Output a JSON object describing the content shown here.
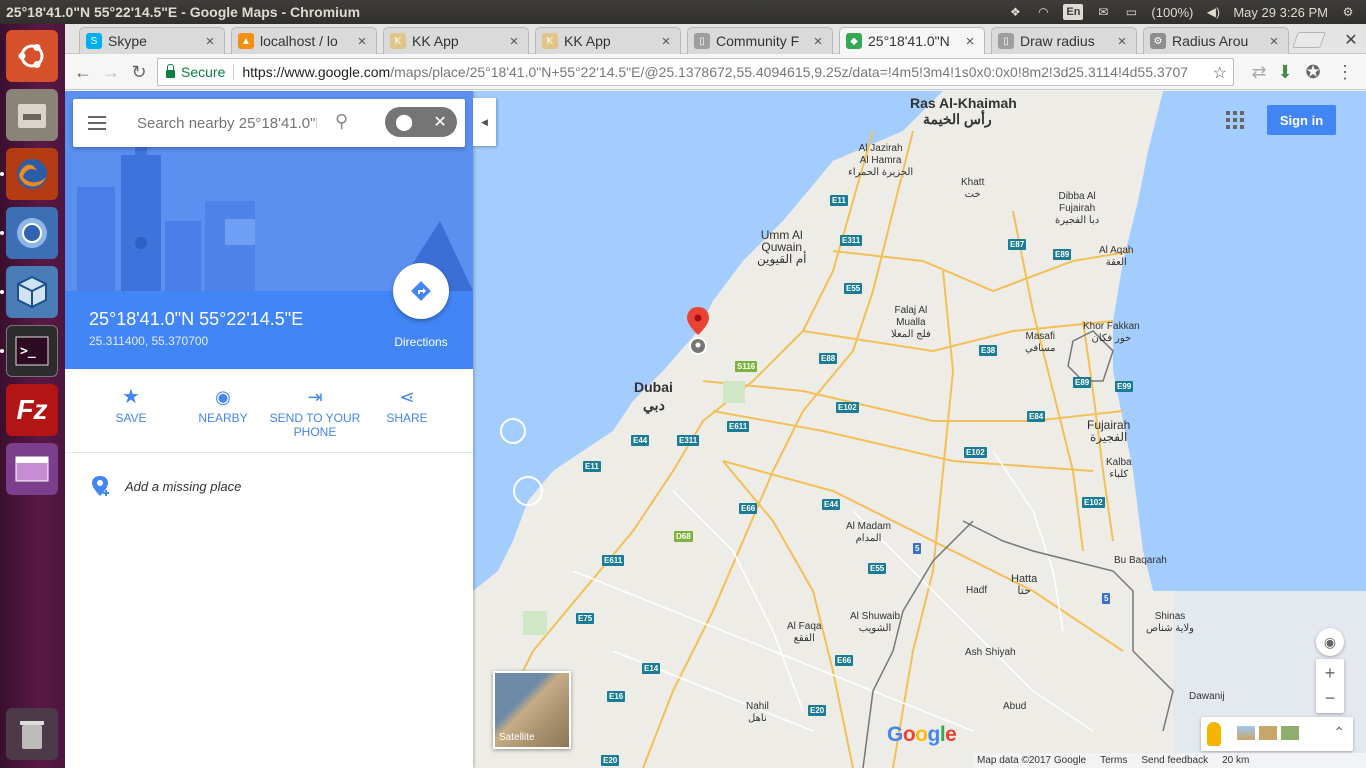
{
  "window_title": "25°18'41.0\"N 55°22'14.5\"E - Google Maps - Chromium",
  "system": {
    "lang": "En",
    "battery": "(100%)",
    "datetime": "May 29  3:26 PM"
  },
  "tabs": [
    {
      "label": "Skype",
      "color": "#00aff0",
      "glyph": "S"
    },
    {
      "label": "localhost / lo",
      "color": "#f29111",
      "glyph": "▲"
    },
    {
      "label": "KK App",
      "color": "#e0c58a",
      "glyph": "K"
    },
    {
      "label": "KK App",
      "color": "#e0c58a",
      "glyph": "K"
    },
    {
      "label": "Community F",
      "color": "#9e9e9e",
      "glyph": "▯"
    },
    {
      "label": "25°18'41.0\"N",
      "color": "#34a853",
      "glyph": "◆"
    },
    {
      "label": "Draw radius",
      "color": "#9e9e9e",
      "glyph": "▯"
    },
    {
      "label": "Radius Arou",
      "color": "#8d8d8d",
      "glyph": "⚙"
    }
  ],
  "address": {
    "secure_label": "Secure",
    "url_host": "https://www.google.com",
    "url_rest": "/maps/place/25°18'41.0\"N+55°22'14.5\"E/@25.1378672,55.4094615,9.25z/data=!4m5!3m4!1s0x0:0x0!8m2!3d25.3114!4d55.3707"
  },
  "panel": {
    "search_placeholder": "Search nearby 25°18'41.0\"N",
    "place_title": "25°18'41.0\"N 55°22'14.5\"E",
    "place_coords": "25.311400, 55.370700",
    "directions_label": "Directions",
    "actions": [
      {
        "label": "SAVE"
      },
      {
        "label": "NEARBY"
      },
      {
        "label": "SEND TO YOUR PHONE"
      },
      {
        "label": "SHARE"
      }
    ],
    "add_place": "Add a missing place"
  },
  "map": {
    "sign_in": "Sign in",
    "satellite_label": "Satellite",
    "footer": {
      "data": "Map data ©2017 Google",
      "terms": "Terms",
      "feedback": "Send feedback",
      "scale": "20 km"
    },
    "labels": [
      {
        "t": "Ras Al-Khaimah",
        "s": "big"
      },
      {
        "t": "رأس الخيمة",
        "s": "big"
      },
      {
        "t": "Al Jazirah\nAl Hamra\nالجزيرة الحمراء"
      },
      {
        "t": "Khatt\nخت"
      },
      {
        "t": "Dibba Al\nFujairah\nدبا الفجيرة"
      },
      {
        "t": "Umm Al\nQuwain\nأم القيوين",
        "s": "big"
      },
      {
        "t": "Al Aqah\nالعقة"
      },
      {
        "t": "Falaj Al\nMualla\nفلج المعلا"
      },
      {
        "t": "Khor Fakkan\nخور فكان"
      },
      {
        "t": "Masafi\nمسافي"
      },
      {
        "t": "Dubai",
        "s": "big"
      },
      {
        "t": "دبي",
        "s": "big"
      },
      {
        "t": "Fujairah\nالفجيرة",
        "s": "big"
      },
      {
        "t": "Kalba\nكلباء"
      },
      {
        "t": "Al Madam\nالمدام"
      },
      {
        "t": "Bu Baqarah"
      },
      {
        "t": "Hatta\nحتا"
      },
      {
        "t": "Hadf"
      },
      {
        "t": "Al Shuwaib\nالشويب"
      },
      {
        "t": "Al Faqa\nالفقع"
      },
      {
        "t": "Shinas\nولاية شناص"
      },
      {
        "t": "Ash Shiyah"
      },
      {
        "t": "Nahil\nناهل"
      },
      {
        "t": "Abud"
      },
      {
        "t": "Dawanij"
      }
    ],
    "shields": [
      "E11",
      "E311",
      "E87",
      "E89",
      "E55",
      "E88",
      "S116",
      "E38",
      "E89",
      "E99",
      "E102",
      "E84",
      "E44",
      "E311",
      "E611",
      "E11",
      "E102",
      "E66",
      "E44",
      "E102",
      "D68",
      "5",
      "E611",
      "E55",
      "E75",
      "5",
      "E66",
      "E14",
      "E16",
      "E20",
      "E20"
    ]
  },
  "colors": {
    "accent": "#4285f4",
    "launcher": "#5a1946",
    "water": "#a3ccff",
    "land": "#eeece6"
  }
}
